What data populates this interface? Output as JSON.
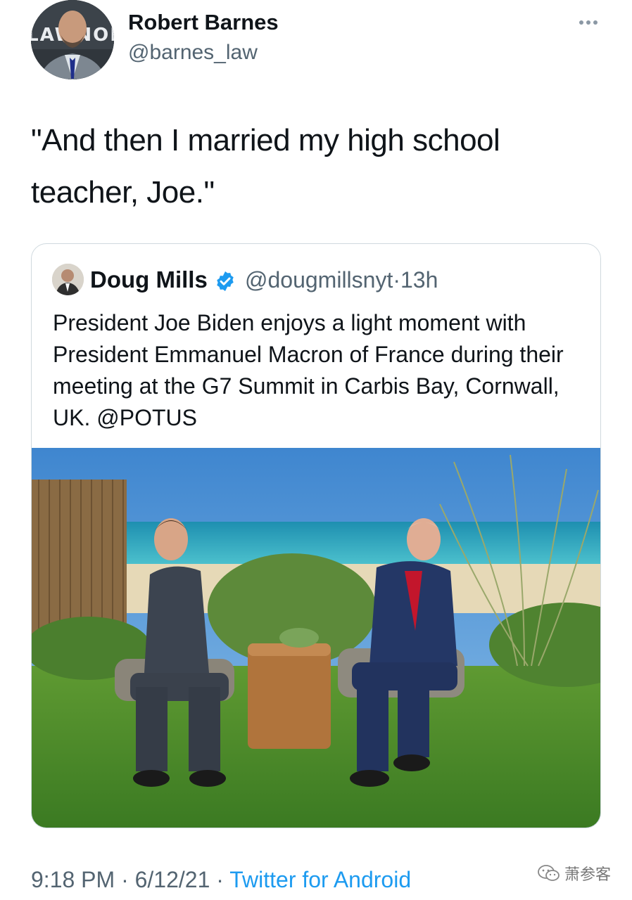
{
  "tweet": {
    "author_name": "Robert Barnes",
    "author_handle": "@barnes_law",
    "avatar_text": "LAWNOI",
    "text": "\"And then I married my high school teacher, Joe.\"",
    "time": "9:18 PM",
    "date": "6/12/21",
    "separator": "·",
    "source": "Twitter for Android"
  },
  "quoted_tweet": {
    "author_name": "Doug Mills",
    "verified": true,
    "author_handle": "@dougmillsnyt",
    "separator": "·",
    "age": "13h",
    "text": "President Joe Biden enjoys a light moment with President Emmanuel Macron of France during their meeting at the G7 Summit in Carbis Bay, Cornwall, UK. @POTUS"
  },
  "watermark": {
    "text": "萧参客",
    "icon": "wechat-icon"
  },
  "icons": {
    "more": "more-dots-icon",
    "verified": "verified-badge-icon"
  },
  "colors": {
    "link": "#1d9bf0",
    "secondary_text": "#536471",
    "border": "#cfd9de",
    "text": "#0f1419"
  }
}
